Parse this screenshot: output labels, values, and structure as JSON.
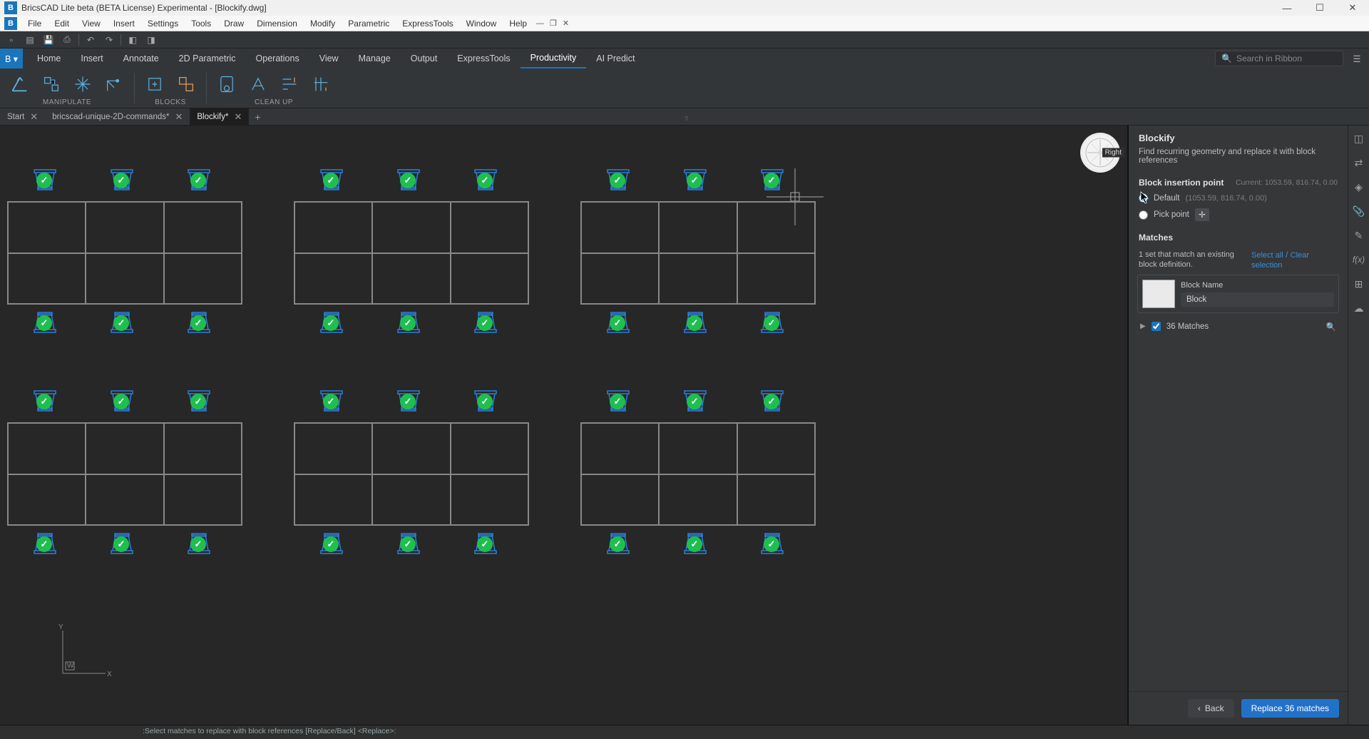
{
  "titlebar": {
    "title": "BricsCAD Lite beta (BETA License) Experimental - [Blockify.dwg]"
  },
  "menu": [
    "File",
    "Edit",
    "View",
    "Insert",
    "Settings",
    "Tools",
    "Draw",
    "Dimension",
    "Modify",
    "Parametric",
    "ExpressTools",
    "Window",
    "Help"
  ],
  "ribbon_tabs": [
    "Home",
    "Insert",
    "Annotate",
    "2D Parametric",
    "Operations",
    "View",
    "Manage",
    "Output",
    "ExpressTools",
    "Productivity",
    "AI Predict"
  ],
  "ribbon_active": "Productivity",
  "search_placeholder": "Search in Ribbon",
  "ribbon_groups": {
    "g1": "MANIPULATE",
    "g2": "BLOCKS",
    "g3": "CLEAN UP"
  },
  "doc_tabs": [
    {
      "label": "Start",
      "active": false
    },
    {
      "label": "bricscad-unique-2D-commands*",
      "active": false
    },
    {
      "label": "Blockify*",
      "active": true
    }
  ],
  "viewcube": {
    "face": "Right"
  },
  "panel": {
    "title": "Blockify",
    "desc": "Find recurring geometry and replace it with block references",
    "insert_section": "Block insertion point",
    "current_label": "Current: 1053.59, 816.74, 0.00",
    "opt_default": "Default",
    "opt_default_coord": "(1053.59, 816.74, 0.00)",
    "opt_pick": "Pick point",
    "matches_section": "Matches",
    "matches_text": "1 set that match an existing block definition.",
    "select_all": "Select all",
    "clear_sel": "Clear selection",
    "block_name_label": "Block Name",
    "block_name_value": "Block",
    "match_count": "36 Matches",
    "back": "Back",
    "replace": "Replace 36 matches"
  },
  "cmdline": ":Select matches to replace with block references [Replace/Back] <Replace>:"
}
